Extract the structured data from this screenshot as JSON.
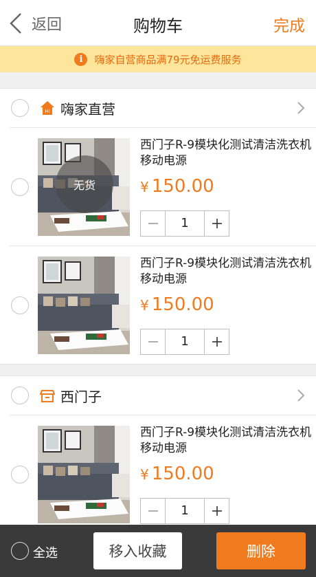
{
  "nav": {
    "back_label": "返回",
    "title": "购物车",
    "done_label": "完成"
  },
  "notice": {
    "icon": "info-icon",
    "icon_glyph": "i",
    "text": "嗨家自营商品满79元免运费服务"
  },
  "shops": [
    {
      "name": "嗨家直营",
      "icon": "home-icon",
      "items": [
        {
          "title": "西门子R-9模块化测试清洁洗衣机移动电源",
          "currency": "¥",
          "price": "150.00",
          "quantity": "1",
          "status": "无货"
        },
        {
          "title": "西门子R-9模块化测试清洁洗衣机移动电源",
          "currency": "¥",
          "price": "150.00",
          "quantity": "1"
        }
      ]
    },
    {
      "name": "西门子",
      "icon": "store-icon",
      "items": [
        {
          "title": "西门子R-9模块化测试清洁洗衣机移动电源",
          "currency": "¥",
          "price": "150.00",
          "quantity": "1"
        }
      ]
    }
  ],
  "bottom": {
    "select_all_label": "全选",
    "favorite_label": "移入收藏",
    "delete_label": "删除"
  },
  "colors": {
    "accent": "#f07b1f",
    "notice_bg": "#fde69c",
    "bottom_bar": "#3a3a3a"
  }
}
